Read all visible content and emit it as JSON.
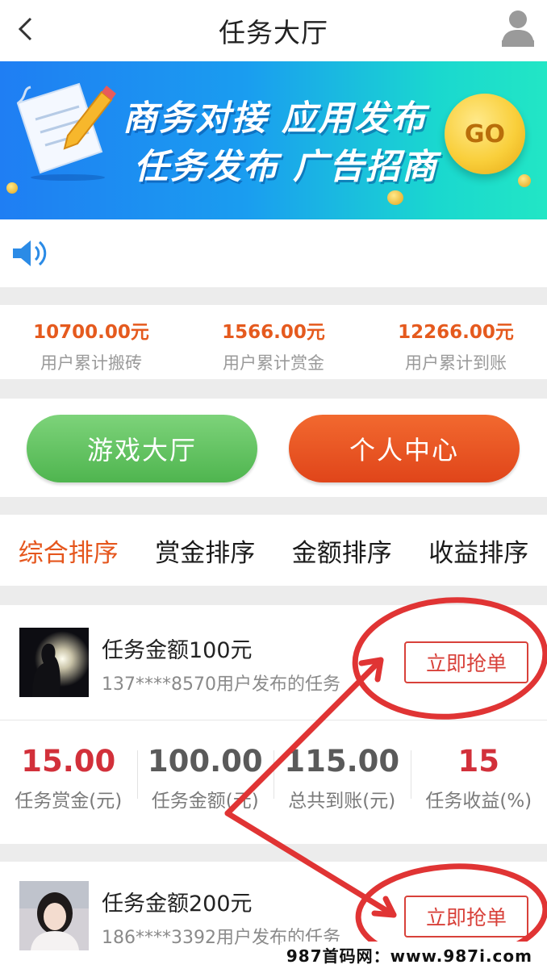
{
  "header": {
    "title": "任务大厅",
    "back_icon": "back-chevron-icon",
    "user_icon": "user-avatar-icon"
  },
  "banner": {
    "line1": "商务对接 应用发布",
    "line2": "任务发布 广告招商",
    "go_label": "GO",
    "colors": {
      "start": "#1f7ef3",
      "end": "#22e6c5"
    }
  },
  "notice": {
    "icon": "speaker-icon"
  },
  "stats": [
    {
      "value": "10700.00元",
      "label": "用户累计搬砖"
    },
    {
      "value": "1566.00元",
      "label": "用户累计赏金"
    },
    {
      "value": "12266.00元",
      "label": "用户累计到账"
    }
  ],
  "actions": {
    "game_hall": "游戏大厅",
    "personal_center": "个人中心"
  },
  "sort_tabs": [
    {
      "label": "综合排序",
      "active": true
    },
    {
      "label": "赏金排序",
      "active": false
    },
    {
      "label": "金额排序",
      "active": false
    },
    {
      "label": "收益排序",
      "active": false
    }
  ],
  "tasks": [
    {
      "amount_title": "任务金额100元",
      "publisher": "137****8570用户发布的任务",
      "grab_label": "立即抢单",
      "metrics": [
        {
          "value": "15.00",
          "label": "任务赏金(元)"
        },
        {
          "value": "100.00",
          "label": "任务金额(元)"
        },
        {
          "value": "115.00",
          "label": "总共到账(元)"
        },
        {
          "value": "15",
          "label": "任务收益(%)"
        }
      ]
    },
    {
      "amount_title": "任务金额200元",
      "publisher": "186****3392用户发布的任务",
      "grab_label": "立即抢单"
    }
  ],
  "watermark": "987首码网：www.987i.com",
  "colors": {
    "accent": "#e5561d",
    "green": "#4fb54f",
    "red": "#d2303a",
    "annotation": "#e03434"
  }
}
